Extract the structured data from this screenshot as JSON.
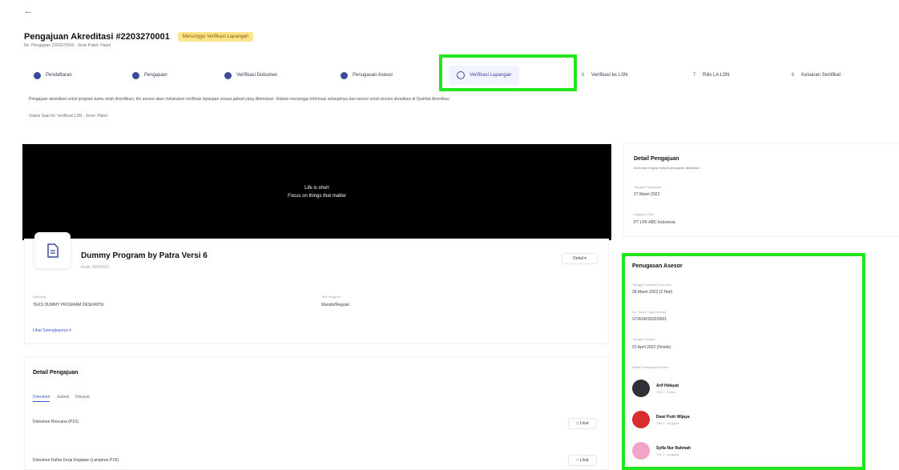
{
  "header": {
    "back_icon": "arrow-left-icon",
    "title": "Pengajuan Akreditasi #2203270001",
    "badge": "Menunggu Verifikasi Lapangan",
    "subtitle": "No. Pengajuan 2203270001 · Jenis Paket: Paket"
  },
  "steps": [
    {
      "label": "Pendaftaran",
      "state": "done"
    },
    {
      "label": "Pengajuan",
      "state": "done"
    },
    {
      "label": "Verifikasi Dokumen",
      "state": "done"
    },
    {
      "label": "Penugasan Asesor",
      "state": "done"
    },
    {
      "label": "Verifikasi Lapangan",
      "state": "active"
    },
    {
      "label": "Verifikasi ke LSN",
      "num": "6"
    },
    {
      "label": "Rilis LA LSN",
      "num": "7"
    },
    {
      "label": "Keluaran Sertifikat",
      "num": "8"
    }
  ],
  "info": {
    "text": "Pengajuan akreditasi untuk program kamu telah diverifikasi, tim asesor akan melakukan verifikasi lapangan sesuai jadwal yang ditentukan. Silakan menunggu informasi selanjutnya dari asesor untuk proses akreditasi di Syahbal Akreditasi",
    "sub": "Status Saat Ini: Verifikasi LSN · Jenis: Paket"
  },
  "video": {
    "line1": "Life is short",
    "line2": "Focus on things that matter"
  },
  "program": {
    "icon": "document-icon",
    "name": "Dummy Program by Patra Versi 6",
    "code": "Kode: AKR0001",
    "detail_label": "Detail",
    "field1_label": "Deskripsi",
    "field1_value": "TEKS DUMMY PROGRAM DESKRIPSI",
    "field2_label": "Tipe Program",
    "field2_value": "Mandiri/Reguler",
    "more_label": "Lihat Selengkapnya"
  },
  "detail_section": {
    "title": "Detail Pengajuan",
    "tabs": [
      "Dokumen",
      "Jadwal",
      "Riwayat"
    ],
    "rows": [
      {
        "label": "Dokumen Rencana (P.01)",
        "action": "Lihat"
      },
      {
        "label": "Dokumen Daftar Kerja Kegiatan (Lampiran P.02)",
        "action": "Lihat"
      }
    ]
  },
  "side_detail": {
    "title": "Detail Pengajuan",
    "subtitle": "Informasi lengkap terkait pengajuan akreditasi",
    "date_label": "Tanggal Pengajuan",
    "date_value": "27 Maret 2022",
    "submitted_label": "Diajukan Oleh",
    "submitted_value": "PT LPK ABC Indonesia"
  },
  "assessor_panel": {
    "title": "Penugasan Asesor",
    "l1": "Tanggal Verifikasi Dokumen",
    "v1": "28 Maret 2022 (2 Hari)",
    "l2": "No. Surat Tugas Asesor",
    "v2": "ST/ASR/2022/0001",
    "l3": "Tanggal Visitasi",
    "v3": "01 April 2022 (Onsite)",
    "l4": "Daftar Penugasan Asesor",
    "people": [
      {
        "name": "Arif Hidayat",
        "role": "TIM 1 · Ketua"
      },
      {
        "name": "Dewi Putri Wijaya",
        "role": "TIM 1 · Anggota"
      },
      {
        "name": "Syifa Nur Rahmah",
        "role": "TIM 1 · Anggota"
      }
    ]
  },
  "colors": {
    "highlight": "#22e61b",
    "accent": "#3b4a9c",
    "badge_bg": "#fde68a"
  }
}
